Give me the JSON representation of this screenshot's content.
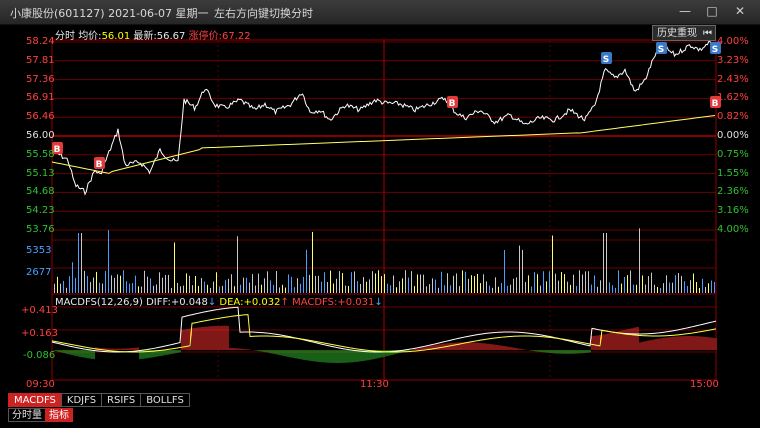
{
  "window": {
    "title": "小康股份(601127) 2021-06-07 星期一",
    "hint": "左右方向键切换分时",
    "minimize": "—",
    "maximize": "□",
    "close": "✕",
    "history_button": "历史重现",
    "history_icon": "skip-back-icon"
  },
  "header": {
    "mode": "分时",
    "avg_label": "均价:",
    "avg_value": "56.01",
    "last_label": "最新:",
    "last_value": "56.67",
    "limit_label": "涨停价:",
    "limit_value": "67.22"
  },
  "price_axis": {
    "left": [
      "58.24",
      "57.81",
      "57.36",
      "56.91",
      "56.46",
      "56.00",
      "55.58",
      "55.13",
      "54.68",
      "54.23",
      "53.76"
    ],
    "right": [
      "4.00%",
      "3.23%",
      "2.43%",
      "1.62%",
      "0.82%",
      "0.00%",
      "0.75%",
      "1.55%",
      "2.36%",
      "3.16%",
      "4.00%"
    ]
  },
  "volume_axis": {
    "left": [
      "5353",
      "2677"
    ]
  },
  "macd": {
    "title": "MACDFS(12,26,9)",
    "diff_label": "DIFF:",
    "diff_value": "+0.048",
    "dea_label": "DEA:",
    "dea_value": "+0.032",
    "macdfs_label": "MACDFS:",
    "macdfs_value": "+0.031",
    "axis": [
      "+0.413",
      "+0.163",
      "-0.086"
    ]
  },
  "time_axis": [
    "09:30",
    "11:30",
    "15:00"
  ],
  "markers": {
    "buy": "B",
    "sell": "S"
  },
  "tabs": [
    {
      "label": "MACDFS",
      "active": true
    },
    {
      "label": "KDJFS",
      "active": false
    },
    {
      "label": "RSIFS",
      "active": false
    },
    {
      "label": "BOLLFS",
      "active": false
    }
  ],
  "tabs2": [
    {
      "label": "分时量",
      "active": false
    },
    {
      "label": "指标",
      "active": true
    }
  ],
  "colors": {
    "price_line": "#ffffff",
    "avg_line": "#ffff66",
    "grid": "#8b0000",
    "buy_marker": "#e03a3a",
    "sell_marker": "#3a78c8",
    "up": "#ff3030",
    "down": "#30c030",
    "volume": "#c8c8c8"
  }
}
